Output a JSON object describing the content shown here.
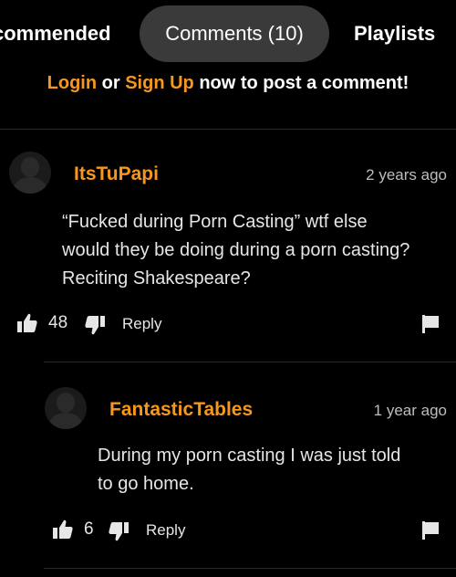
{
  "tabs": {
    "recommended": "commended",
    "comments": "Comments (10)",
    "playlists": "Playlists"
  },
  "login_prompt": {
    "login": "Login",
    "or": " or ",
    "signup": "Sign Up",
    "rest": " now to post a comment!"
  },
  "comments": [
    {
      "user": "ItsTuPapi",
      "time": "2 years ago",
      "lines": [
        "“Fucked during Porn Casting” wtf else",
        "would they be doing during a porn casting?",
        "Reciting Shakespeare?"
      ],
      "likes": "48",
      "reply": "Reply"
    },
    {
      "user": "FantasticTables",
      "time": "1 year ago",
      "lines": [
        "During my porn casting I was just told",
        "to go home."
      ],
      "likes": "6",
      "reply": "Reply"
    }
  ],
  "colors": {
    "accent": "#f7971d",
    "background": "#000000",
    "tab_active_bg": "#3a3a3a"
  },
  "icons": {
    "like": "thumbs-up-icon",
    "dislike": "thumbs-down-icon",
    "flag": "flag-icon",
    "avatar": "default-avatar-icon"
  }
}
